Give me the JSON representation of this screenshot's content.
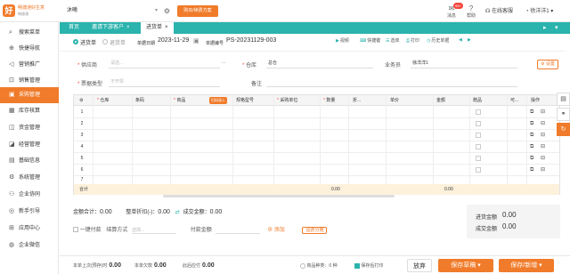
{
  "app": {
    "logo_text": "畅捷通好生意",
    "logo_sub": "畅捷通",
    "tenant": "沐曦",
    "plan_button": "购买/续费方案",
    "messages_label": "消息",
    "messages_badge": "99+",
    "help_label": "帮助",
    "service_label": "在线客服",
    "user_label": "徐洋洋1"
  },
  "sidebar": {
    "items": [
      {
        "label": "搜索菜单",
        "icon": "search-icon"
      },
      {
        "label": "快捷导航",
        "icon": "compass-icon"
      },
      {
        "label": "营销推广",
        "icon": "megaphone-icon"
      },
      {
        "label": "销售管理",
        "icon": "cart-icon"
      },
      {
        "label": "采购管理",
        "icon": "purchase-icon",
        "active": true
      },
      {
        "label": "库存核算",
        "icon": "warehouse-icon"
      },
      {
        "label": "资金管理",
        "icon": "wallet-icon"
      },
      {
        "label": "经营管理",
        "icon": "chart-icon"
      },
      {
        "label": "基础信息",
        "icon": "info-icon"
      },
      {
        "label": "系统管理",
        "icon": "gear-icon"
      },
      {
        "label": "企业协同",
        "icon": "team-icon"
      },
      {
        "label": "新手引导",
        "icon": "guide-icon"
      },
      {
        "label": "应用中心",
        "icon": "apps-icon"
      },
      {
        "label": "企业微信",
        "icon": "wechat-icon"
      }
    ]
  },
  "tabs": [
    {
      "label": "首页",
      "closable": false
    },
    {
      "label": "邀请下游客户",
      "closable": true
    },
    {
      "label": "进货单",
      "closable": true,
      "active": true
    }
  ],
  "toolbar": {
    "mode_purchase": "进货单",
    "mode_return": "退货单",
    "date_label": "单据日期",
    "date_value": "2023-11-29",
    "number_label": "单据编号",
    "number_value": "PS-20231129-003",
    "buttons": [
      "视频",
      "快捷键",
      "选单",
      "打印",
      "历史单据"
    ]
  },
  "form": {
    "supplier_label": "供应商",
    "supplier_placeholder": "请选...",
    "warehouse_label": "仓库",
    "warehouse_value": "总仓",
    "clerk_label": "业务员",
    "clerk_value": "徐洋洋1",
    "settings_button": "设置",
    "billtype_label": "票据类型",
    "billtype_placeholder": "不开票",
    "remark_label": "备注"
  },
  "grid": {
    "columns": [
      "仓库",
      "条码",
      "商品",
      "规格型号",
      "采购单位",
      "数量",
      "折...",
      "单价",
      "金额",
      "赠品",
      "可...",
      "操作"
    ],
    "pill": "扫码录入",
    "rows": [
      "1",
      "2",
      "3",
      "4",
      "5",
      "6",
      "7"
    ],
    "total_label": "合计",
    "total_qty": "0.00",
    "total_amount": "0.00"
  },
  "summary": {
    "amount_total_label": "金额合计：",
    "amount_total_value": "0.00",
    "discount_label": "整单折扣(-)：",
    "discount_value": "0.00",
    "deal_label": "成交金额：",
    "deal_value": "0.00",
    "purchase_amount_label": "进货金额",
    "purchase_amount_value": "0.00",
    "deal_amount_label": "成交金额",
    "deal_amount_value": "0.00"
  },
  "payment": {
    "onekey_label": "一键付款",
    "account_label": "结算方式",
    "account_placeholder": "选择...",
    "paid_label": "付款金额",
    "add_label": "添加",
    "freight_button": "运费分摊"
  },
  "footer": {
    "unpaid_label": "本单上次(预存)时",
    "unpaid_value": "0.00",
    "debt_label": "本单欠款",
    "debt_value": "0.00",
    "shipped_label": "此后应付",
    "shipped_value": "0.00",
    "product_label": "商品种类：",
    "product_value": "0",
    "product_unit": "种",
    "print_label": "保存后打印",
    "abandon_button": "放弃",
    "save_button": "保存草稿",
    "save_new_button": "保存/新增"
  },
  "colors": {
    "accent": "#f07b2a",
    "tab_bar": "#2bb3ad"
  }
}
